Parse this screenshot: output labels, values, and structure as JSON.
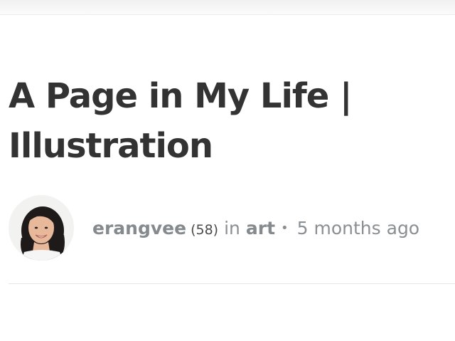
{
  "post": {
    "title": "A Page in My Life | Illustration",
    "author": "erangvee",
    "reputation": "(58)",
    "in_text": "in",
    "category": "art",
    "bullet": "•",
    "time_ago": "5 months ago"
  },
  "icons": {
    "avatar": "user-avatar-photo"
  }
}
